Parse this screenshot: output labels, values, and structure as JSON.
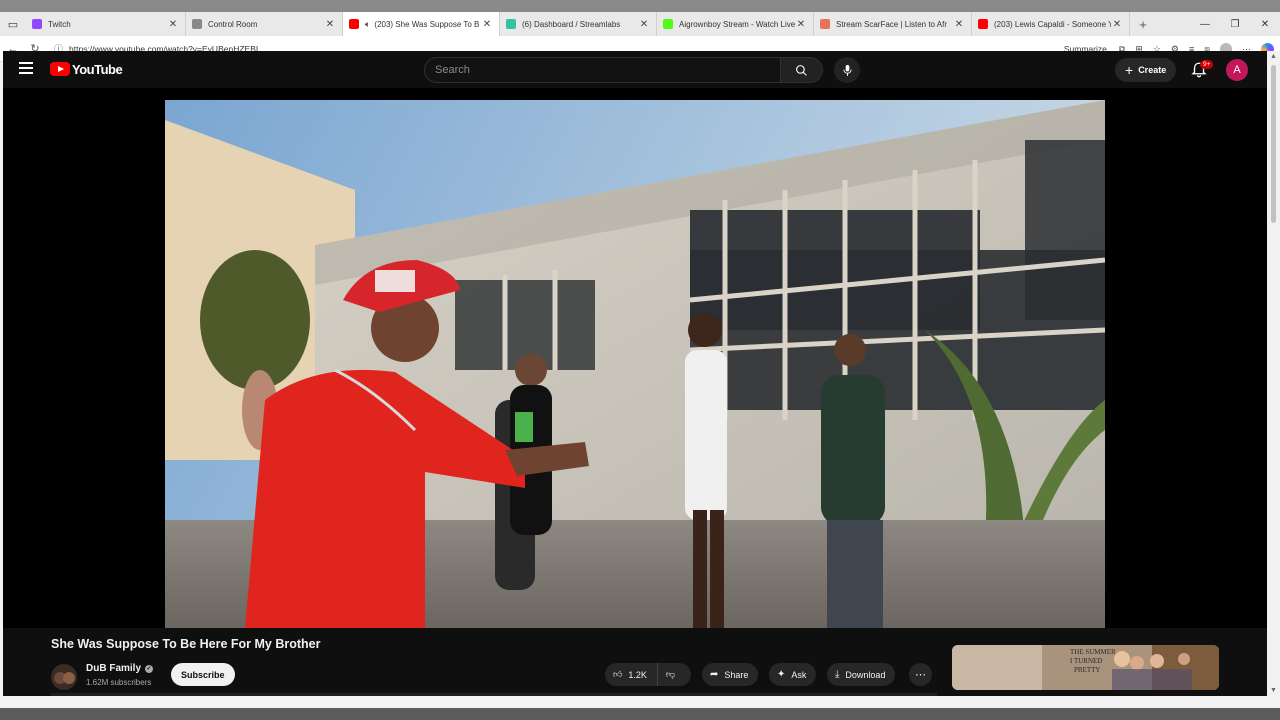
{
  "browser": {
    "tabs": [
      {
        "title": "Twitch",
        "favicon_color": "#9146ff",
        "active": false,
        "audio": false
      },
      {
        "title": "Control Room",
        "favicon_color": "#888888",
        "active": false,
        "audio": false
      },
      {
        "title": "(203) She Was Suppose To B",
        "favicon_color": "#ff0000",
        "active": true,
        "audio": true
      },
      {
        "title": "(6) Dashboard / Streamlabs",
        "favicon_color": "#31c3a2",
        "active": false,
        "audio": false
      },
      {
        "title": "Aigrownboy Stream - Watch Live",
        "favicon_color": "#53fc18",
        "active": false,
        "audio": false
      },
      {
        "title": "Stream ScarFace | Listen to Afr",
        "favicon_color": "#e8735a",
        "active": false,
        "audio": false
      },
      {
        "title": "(203) Lewis Capaldi - Someone Y",
        "favicon_color": "#ff0000",
        "active": false,
        "audio": false
      }
    ],
    "url": "https://www.youtube.com/watch?v=EyUBenHZEBI",
    "summarize_label": "Summarize"
  },
  "youtube": {
    "logo_text": "YouTube",
    "search_placeholder": "Search",
    "create_label": "Create",
    "notification_badge": "9+",
    "account_initial": "A",
    "video": {
      "title": "She Was Suppose To Be Here For My Brother",
      "channel": "DuB Family",
      "subscribers": "1.62M subscribers",
      "subscribe_label": "Subscribe",
      "likes": "1.2K",
      "share_label": "Share",
      "ask_label": "Ask",
      "download_label": "Download"
    },
    "recommended_thumb_text": [
      "THE SUMMER",
      "I TURNED",
      "PRETTY"
    ]
  },
  "colors": {
    "youtube_red": "#ff0000",
    "background": "#0f0f0f",
    "avatar": "#c2185b"
  }
}
